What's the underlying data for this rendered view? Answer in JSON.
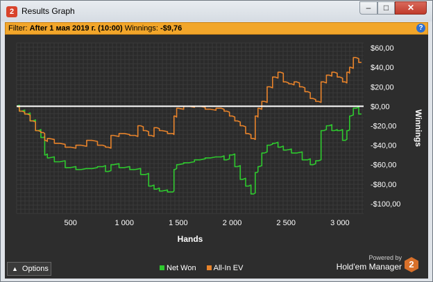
{
  "window": {
    "title": "Results Graph",
    "app_icon": "2",
    "minimize": "–",
    "maximize": "□",
    "close": "✕"
  },
  "filter": {
    "label": "Filter:",
    "value": "After 1 мая 2019 г. (10:00)",
    "winnings_label": "Winnings:",
    "winnings_value": "-$9,76"
  },
  "help_label": "?",
  "options_label": "Options",
  "branding": {
    "powered": "Powered by",
    "name": "Hold'em Manager",
    "logo": "2"
  },
  "colors": {
    "net_won": "#2ec92e",
    "all_in_ev": "#e8832a",
    "zero_line": "#ffffff",
    "background": "#2d2d2d",
    "filter_bar": "#f2a62a"
  },
  "chart_data": {
    "type": "line",
    "xlabel": "Hands",
    "ylabel": "Winnings",
    "xlim": [
      0,
      3220
    ],
    "ylim": [
      -110,
      65
    ],
    "xticks": [
      500,
      1000,
      1500,
      2000,
      2500,
      3000
    ],
    "xtick_labels": [
      "500",
      "1 000",
      "1 500",
      "2 000",
      "2 500",
      "3 000"
    ],
    "yticks": [
      60,
      40,
      20,
      0,
      -20,
      -40,
      -60,
      -80,
      -100
    ],
    "ytick_labels": [
      "$60,00",
      "$40,00",
      "$20,00",
      "$0,00",
      "-$20,00",
      "-$40,00",
      "-$60,00",
      "-$80,00",
      "-$100,00"
    ],
    "grid": true,
    "legend": "bottom-center",
    "series": [
      {
        "name": "Net Won",
        "color": "#2ec92e",
        "x": [
          0,
          50,
          100,
          150,
          200,
          250,
          270,
          300,
          400,
          500,
          600,
          700,
          800,
          850,
          900,
          1000,
          1100,
          1200,
          1250,
          1300,
          1350,
          1450,
          1470,
          1500,
          1600,
          1700,
          1800,
          1900,
          1950,
          2000,
          2050,
          2100,
          2150,
          2200,
          2230,
          2250,
          2300,
          2350,
          2400,
          2450,
          2500,
          2600,
          2700,
          2750,
          2800,
          2850,
          2900,
          2950,
          3000,
          3050,
          3080,
          3100,
          3150,
          3200
        ],
        "y": [
          0,
          -5,
          -8,
          -15,
          -25,
          -32,
          -50,
          -53,
          -57,
          -63,
          -65,
          -64,
          -62,
          -67,
          -60,
          -63,
          -65,
          -70,
          -82,
          -85,
          -87,
          -88,
          -65,
          -60,
          -58,
          -55,
          -53,
          -52,
          -55,
          -50,
          -62,
          -75,
          -82,
          -90,
          -68,
          -62,
          -48,
          -40,
          -38,
          -42,
          -45,
          -48,
          -55,
          -60,
          -56,
          -25,
          -20,
          -25,
          -25,
          -35,
          -25,
          -10,
          -2,
          -8
        ]
      },
      {
        "name": "All-In EV",
        "color": "#e8832a",
        "x": [
          0,
          50,
          100,
          150,
          200,
          250,
          270,
          300,
          400,
          500,
          600,
          700,
          800,
          850,
          900,
          1000,
          1100,
          1150,
          1200,
          1250,
          1300,
          1350,
          1450,
          1470,
          1500,
          1600,
          1700,
          1800,
          1900,
          1950,
          2000,
          2050,
          2100,
          2150,
          2200,
          2230,
          2250,
          2300,
          2350,
          2400,
          2450,
          2500,
          2550,
          2600,
          2650,
          2700,
          2750,
          2800,
          2850,
          2900,
          2950,
          3000,
          3050,
          3080,
          3100,
          3150,
          3200
        ],
        "y": [
          0,
          -5,
          -8,
          -15,
          -25,
          -27,
          -35,
          -33,
          -38,
          -42,
          -40,
          -35,
          -40,
          -42,
          -30,
          -28,
          -30,
          -20,
          -25,
          -30,
          -22,
          -25,
          -28,
          -10,
          -2,
          0,
          0,
          -3,
          -2,
          -5,
          -10,
          -15,
          -20,
          -28,
          -33,
          -10,
          -2,
          5,
          20,
          30,
          35,
          25,
          23,
          25,
          20,
          15,
          8,
          5,
          25,
          32,
          35,
          30,
          25,
          35,
          40,
          50,
          45
        ]
      }
    ]
  }
}
